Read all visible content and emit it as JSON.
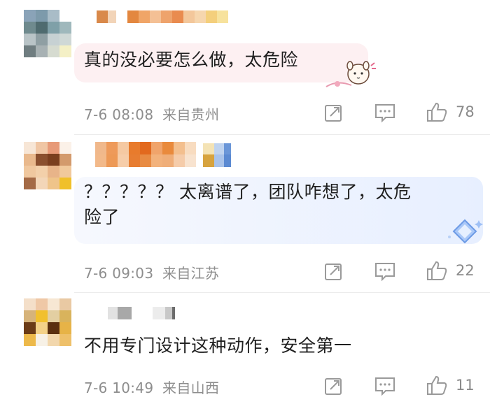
{
  "comments": [
    {
      "text": "真的没必要怎么做，太危险",
      "time": "7-6 08:08",
      "location": "来自贵州",
      "likes": "78",
      "icons": [
        "share-icon",
        "comment-icon",
        "thumbs-up-icon"
      ]
    },
    {
      "text_line1": "？？？？？ 太离谱了，团队咋想了，太危",
      "text_line2": "险了",
      "time": "7-6 09:03",
      "location": "来自江苏",
      "likes": "22",
      "icons": [
        "share-icon",
        "comment-icon",
        "thumbs-up-icon"
      ]
    },
    {
      "text": "不用专门设计这种动作，安全第一",
      "time": "7-6 10:49",
      "location": "来自山西",
      "likes": "11",
      "icons": [
        "share-icon",
        "comment-icon",
        "thumbs-up-icon"
      ]
    }
  ],
  "colors": {
    "bubble1": "#fdf0f2",
    "bubble2": "#eef3fd",
    "meta_text": "#8d8d8d",
    "icon": "#9a9a9a"
  }
}
